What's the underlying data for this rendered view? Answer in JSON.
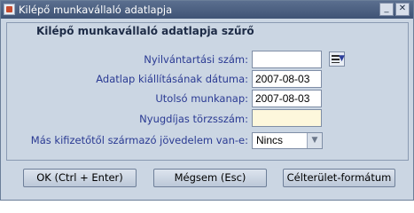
{
  "window": {
    "title": "Kilépő munkavállaló adatlapja",
    "minimize_glyph": "_",
    "close_glyph": "✕"
  },
  "form": {
    "section_title": "Kilépő munkavállaló adatlapja szűrő",
    "fields": {
      "nyilvantartasi_szam": {
        "label": "Nyilvántartási szám:",
        "value": ""
      },
      "adatlap_datuma": {
        "label": "Adatlap kiállításának dátuma:",
        "value": "2007-08-03"
      },
      "utolso_munkanap": {
        "label": "Utolsó munkanap:",
        "value": "2007-08-03"
      },
      "nyugdijas_torzsszam": {
        "label": "Nyugdíjas törzsszám:",
        "value": ""
      },
      "mas_kifizeto": {
        "label": "Más kifizetőtől származó jövedelem van-e:",
        "value": "Nincs"
      }
    },
    "lov_icon": "list-of-values-icon"
  },
  "buttons": {
    "ok": "OK (Ctrl + Enter)",
    "cancel": "Mégsem (Esc)",
    "format": "Célterület-formátum"
  },
  "colors": {
    "background": "#cbd6e3",
    "label": "#2a3a93",
    "titlebar": "#4a5e80",
    "required_field": "#fdf7dc"
  }
}
